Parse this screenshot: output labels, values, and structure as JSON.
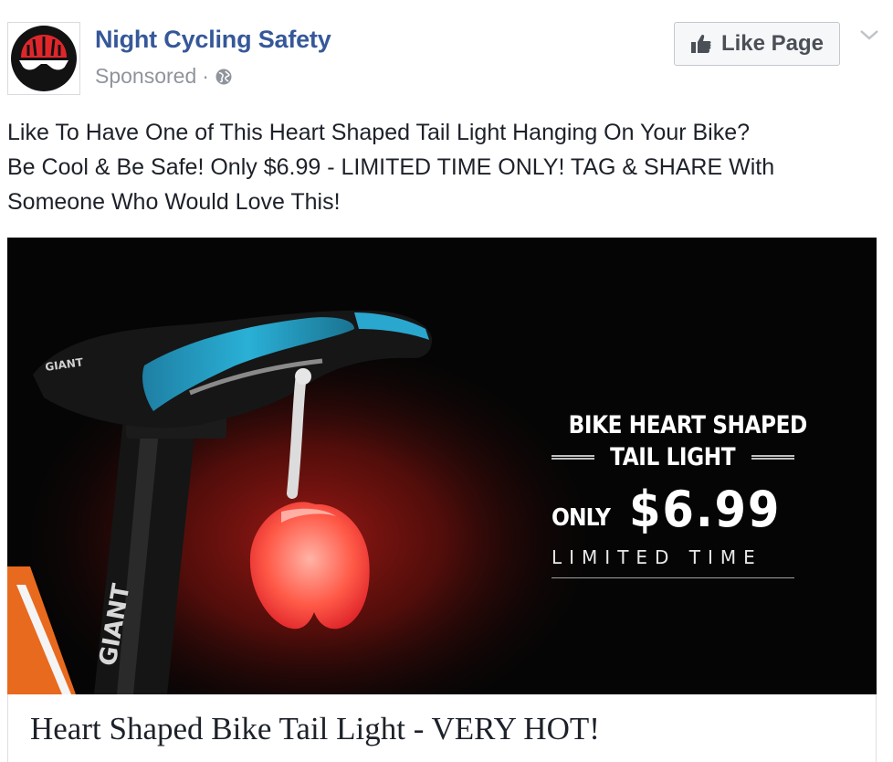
{
  "post": {
    "page_name": "Night Cycling Safety",
    "sponsored_label": "Sponsored",
    "separator": "·",
    "like_button_label": "Like Page",
    "body_lines": [
      "Like To Have One of This Heart Shaped Tail Light Hanging On Your Bike?",
      "Be Cool & Be Safe! Only $6.99 - LIMITED TIME ONLY! TAG & SHARE With",
      "Someone Who Would Love This!"
    ]
  },
  "ad": {
    "brand_on_saddle": "GIANT",
    "promo_line1": "BIKE HEART SHAPED",
    "promo_line2": "TAIL LIGHT",
    "only_label": "ONLY",
    "price": "$6.99",
    "limited_label": "LIMITED TIME",
    "link_title": "Heart Shaped Bike Tail Light - VERY HOT!"
  },
  "icons": {
    "avatar": "cycling-helmet-logo",
    "privacy": "globe-icon",
    "like": "thumbs-up-icon",
    "menu": "chevron-down-icon"
  },
  "colors": {
    "page_name": "#365899",
    "meta_text": "#90949c",
    "body_text": "#1d2129",
    "accent_red": "#e0262b",
    "saddle_blue": "#2a9fc4"
  }
}
